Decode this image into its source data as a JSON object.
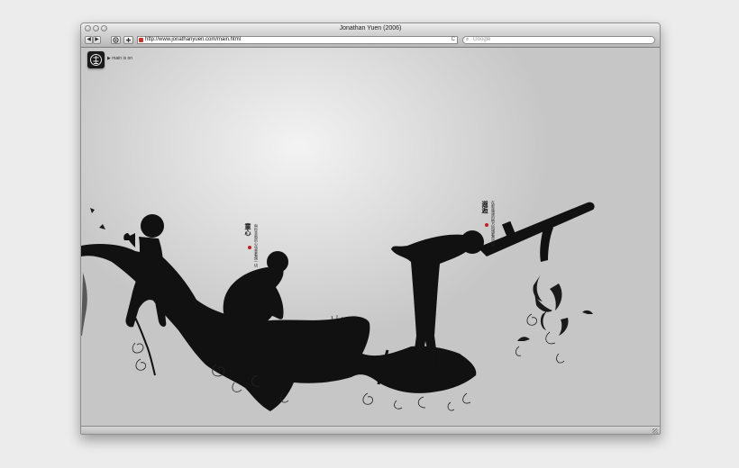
{
  "window": {
    "title": "Jonathan Yuen (2006)"
  },
  "toolbar": {
    "back_glyph": "◀",
    "forward_glyph": "▶",
    "address": "http://www.jonathanyuen.com/main.html",
    "reload_glyph": "C",
    "search_placeholder": "Google",
    "search_glyph": "⌕"
  },
  "page": {
    "nav_label": "▶ main is on",
    "left_poem": {
      "title": "童心",
      "text": "與你並肩的心也曾看過一切"
    },
    "right_poem": {
      "title": "遐逅",
      "text": "在那遙遠的地方回頭看見自然"
    }
  },
  "icons": {
    "logo": "ink-seal-logo-icon",
    "favicon": "red-site-favicon-icon",
    "search": "magnifier-icon",
    "reload": "reload-icon"
  },
  "colors": {
    "ink": "#111111",
    "seal_red": "#c02020",
    "background": "#c9c9c9"
  }
}
